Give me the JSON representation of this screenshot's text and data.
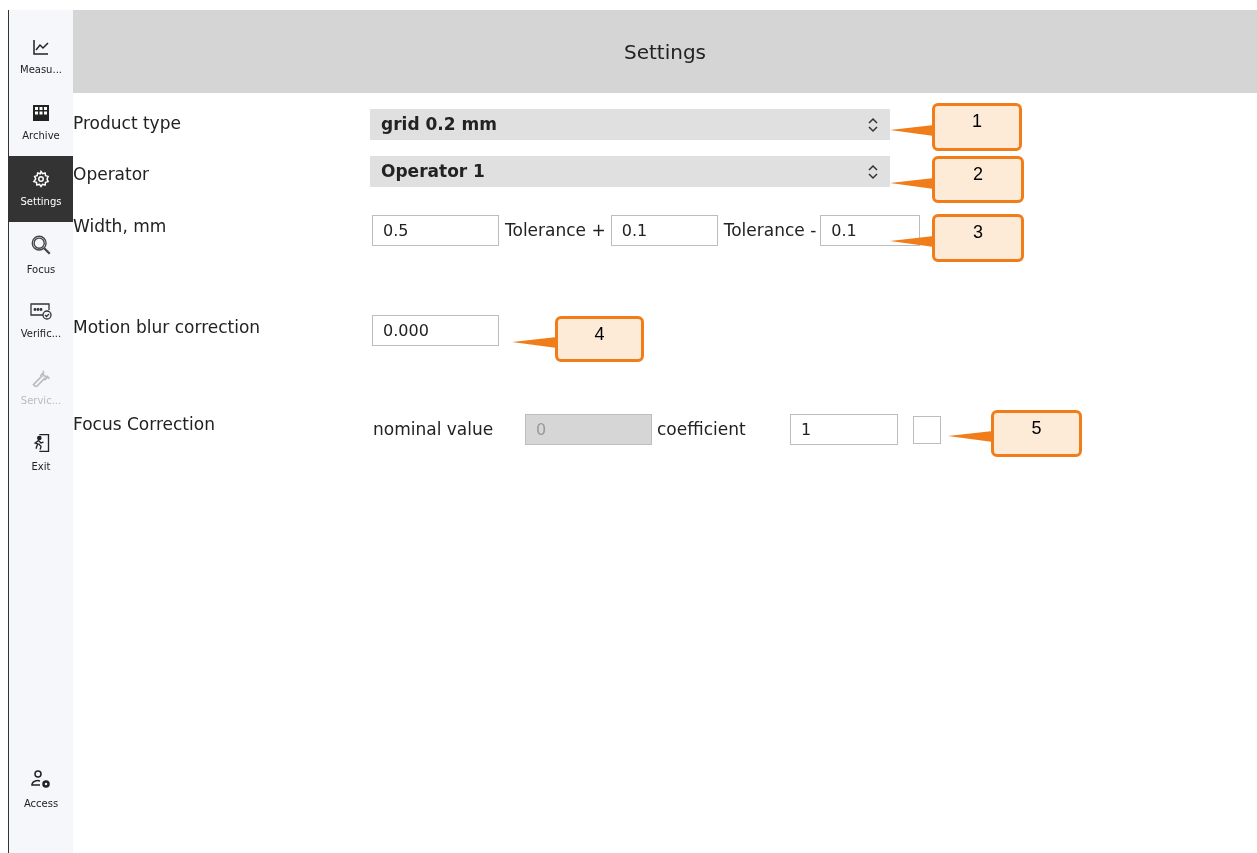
{
  "sidebar": {
    "items": [
      {
        "label": "Measu...",
        "kind": "chart",
        "selected": false,
        "disabled": false
      },
      {
        "label": "Archive",
        "kind": "grid",
        "selected": false,
        "disabled": false
      },
      {
        "label": "Settings",
        "kind": "gear",
        "selected": true,
        "disabled": false
      },
      {
        "label": "Focus",
        "kind": "search",
        "selected": false,
        "disabled": false
      },
      {
        "label": "Verific...",
        "kind": "verify",
        "selected": false,
        "disabled": false
      },
      {
        "label": "Servic...",
        "kind": "wrench",
        "selected": false,
        "disabled": true
      },
      {
        "label": "Exit",
        "kind": "exit",
        "selected": false,
        "disabled": false
      }
    ],
    "bottom_item": {
      "label": "Access",
      "kind": "access",
      "selected": false,
      "disabled": false
    }
  },
  "header": {
    "title": "Settings"
  },
  "settings": {
    "product_type": {
      "label": "Product type",
      "value": "grid 0.2 mm"
    },
    "operator": {
      "label": "Operator",
      "value": "Operator 1"
    },
    "width": {
      "label": "Width, mm",
      "value": "0.5",
      "tolerance_plus_label": "Tolerance +",
      "tolerance_plus": "0.1",
      "tolerance_minus_label": "Tolerance -",
      "tolerance_minus": "0.1"
    },
    "motion_blur": {
      "label": "Motion blur correction",
      "value": "0.000"
    },
    "focus_correction": {
      "label": "Focus Correction",
      "nominal_label": "nominal value",
      "nominal_value": "0",
      "nominal_disabled": true,
      "coefficient_label": "coefficient",
      "coefficient": "1",
      "checked": false
    }
  },
  "callouts": [
    {
      "label": "1"
    },
    {
      "label": "2"
    },
    {
      "label": "3"
    },
    {
      "label": "4"
    },
    {
      "label": "5"
    }
  ]
}
